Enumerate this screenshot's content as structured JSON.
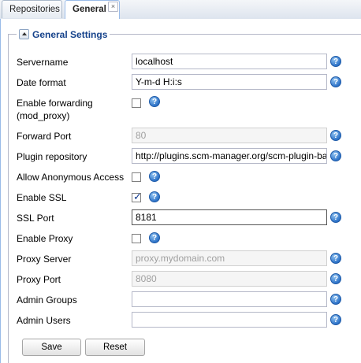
{
  "tabs": [
    {
      "label": "Repositories",
      "active": false
    },
    {
      "label": "General",
      "active": true,
      "close": "×"
    }
  ],
  "section": {
    "title": "General Settings"
  },
  "fields": {
    "servername": {
      "label": "Servername",
      "value": "localhost"
    },
    "date_format": {
      "label": "Date format",
      "value": "Y-m-d H:i:s"
    },
    "enable_forwarding": {
      "label_line1": "Enable forwarding",
      "label_line2": "(mod_proxy)",
      "checked": false
    },
    "forward_port": {
      "label": "Forward Port",
      "value": "80",
      "disabled": true
    },
    "plugin_repository": {
      "label": "Plugin repository",
      "value": "http://plugins.scm-manager.org/scm-plugin-backend"
    },
    "allow_anonymous": {
      "label": "Allow Anonymous Access",
      "checked": false
    },
    "enable_ssl": {
      "label": "Enable SSL",
      "checked": true
    },
    "ssl_port": {
      "label": "SSL Port",
      "value": "8181"
    },
    "enable_proxy": {
      "label": "Enable Proxy",
      "checked": false
    },
    "proxy_server": {
      "label": "Proxy Server",
      "placeholder": "proxy.mydomain.com",
      "disabled": true
    },
    "proxy_port": {
      "label": "Proxy Port",
      "placeholder": "8080",
      "disabled": true
    },
    "admin_groups": {
      "label": "Admin Groups",
      "value": ""
    },
    "admin_users": {
      "label": "Admin Users",
      "value": ""
    }
  },
  "help_icon": "?",
  "checkmark": "✓",
  "buttons": {
    "save": "Save",
    "reset": "Reset"
  },
  "icons": {
    "help": "help-icon",
    "collapse": "collapse-icon",
    "close": "close-icon"
  }
}
